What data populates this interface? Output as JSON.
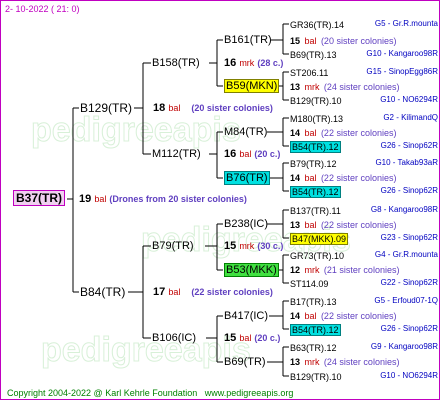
{
  "header": {
    "date": "2- 10-2022 ( 21: 0)"
  },
  "footer": {
    "copyright": "Copyright 2004-2022 @ Karl Kehrle Foundation",
    "url": "www.pedigreeapis.org"
  },
  "watermark": {
    "text": "pedigreeapis"
  },
  "root": {
    "name": "B37(TR)",
    "number": "19",
    "unit": "bal",
    "note": "(Drones from 20 sister colonies)"
  },
  "gen1": [
    {
      "name": "B129(TR)",
      "number": "18",
      "unit": "bal",
      "note": "(20 sister colonies)"
    },
    {
      "name": "B84(TR)",
      "number": "17",
      "unit": "bal",
      "note": "(22 sister colonies)"
    }
  ],
  "gen2": [
    {
      "name": "B158(TR)",
      "number": "16",
      "unit": "mrk",
      "note": "(28 c.)"
    },
    {
      "name": "M112(TR)",
      "number": "16",
      "unit": "bal",
      "note": "(20 c.)"
    },
    {
      "name": "B79(TR)",
      "number": "15",
      "unit": "mrk",
      "note": "(30 c.)"
    },
    {
      "name": "B106(IC)",
      "number": "15",
      "unit": "bal",
      "note": "(20 c.)"
    }
  ],
  "gen3": [
    {
      "name": "B161(TR)",
      "hl": ""
    },
    {
      "name": "B59(MKN)",
      "hl": "y"
    },
    {
      "name": "M84(TR)",
      "hl": ""
    },
    {
      "name": "B76(TR)",
      "hl": "c"
    },
    {
      "name": "B238(IC)",
      "hl": ""
    },
    {
      "name": "B53(MKK)",
      "hl": "g"
    },
    {
      "name": "B417(IC)",
      "hl": ""
    },
    {
      "name": "B69(TR)",
      "hl": ""
    }
  ],
  "gen4": [
    {
      "name": "GR36(TR).14",
      "hl": "",
      "ref": "G5 - Gr.R.mounta"
    },
    {
      "num": "15",
      "unit": "bal",
      "note": "(20 sister colonies)"
    },
    {
      "name": "B69(TR).13",
      "hl": "",
      "ref": "G10 - Kangaroo98R"
    },
    {
      "name": "ST206.11",
      "hl": "",
      "ref": "G15 - SinopEgg86R"
    },
    {
      "num": "13",
      "unit": "mrk",
      "note": "(24 sister colonies)"
    },
    {
      "name": "B129(TR).10",
      "hl": "",
      "ref": "G10 - NO6294R"
    },
    {
      "name": "M180(TR).13",
      "hl": "",
      "ref": "G2 - KilimandQ"
    },
    {
      "num": "14",
      "unit": "bal",
      "note": "(22 sister colonies)"
    },
    {
      "name": "B54(TR).12",
      "hl": "c",
      "ref": "G26 - Sinop62R"
    },
    {
      "name": "B79(TR).12",
      "hl": "",
      "ref": "G10 - Takab93aR"
    },
    {
      "num": "14",
      "unit": "bal",
      "note": "(22 sister colonies)"
    },
    {
      "name": "B54(TR).12",
      "hl": "c",
      "ref": "G26 - Sinop62R"
    },
    {
      "name": "B137(TR).11",
      "hl": "",
      "ref": "G8 - Kangaroo98R"
    },
    {
      "num": "13",
      "unit": "bal",
      "note": "(22 sister colonies)"
    },
    {
      "name": "B47(MKK).09",
      "hl": "y",
      "ref": "G23 - Sinop62R"
    },
    {
      "name": "GR73(TR).10",
      "hl": "",
      "ref": "G4 - Gr.R.mounta"
    },
    {
      "num": "12",
      "unit": "mrk",
      "note": "(21 sister colonies)"
    },
    {
      "name": "ST114.09",
      "hl": "",
      "ref": "G22 - Sinop62R"
    },
    {
      "name": "B17(TR).13",
      "hl": "",
      "ref": "G5 - Erfoud07-1Q"
    },
    {
      "num": "14",
      "unit": "bal",
      "note": "(22 sister colonies)"
    },
    {
      "name": "B54(TR).12",
      "hl": "c",
      "ref": "G26 - Sinop62R"
    },
    {
      "name": "B63(TR).12",
      "hl": "",
      "ref": "G9 - Kangaroo98R"
    },
    {
      "num": "13",
      "unit": "mrk",
      "note": "(24 sister colonies)"
    },
    {
      "name": "B129(TR).10",
      "hl": "",
      "ref": "G10 - NO6294R"
    }
  ]
}
